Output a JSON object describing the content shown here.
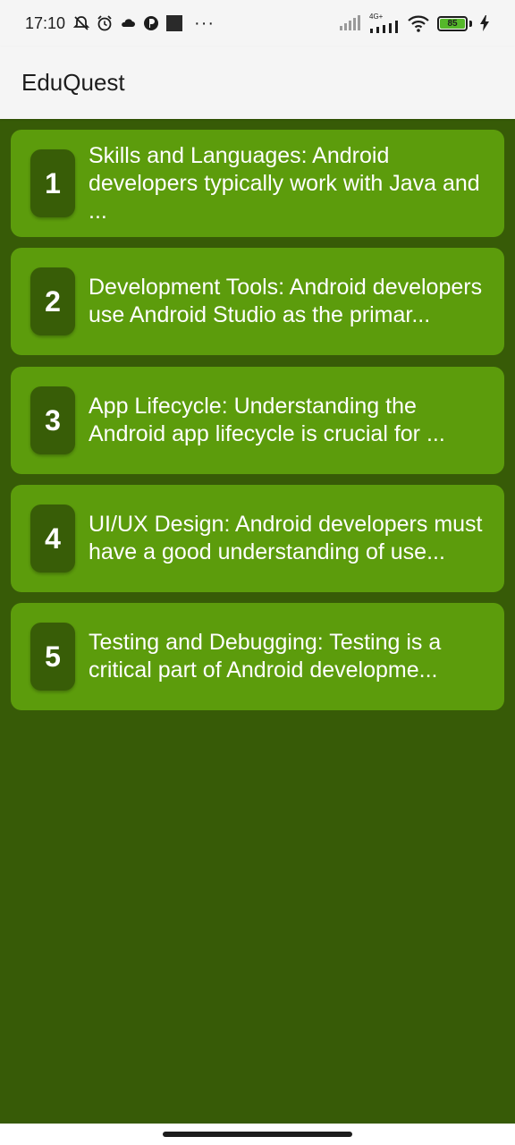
{
  "status_bar": {
    "time": "17:10",
    "more_label": "···",
    "network_label": "4G+",
    "battery_level": "85"
  },
  "app_bar": {
    "title": "EduQuest"
  },
  "colors": {
    "background": "#375b07",
    "card": "#5c9c0c",
    "badge": "#385d07",
    "app_bar": "#f5f5f5"
  },
  "items": [
    {
      "number": "1",
      "text": "Skills and Languages: Android developers typically work with Java and ..."
    },
    {
      "number": "2",
      "text": "Development Tools: Android developers use Android Studio as the primar..."
    },
    {
      "number": "3",
      "text": "App Lifecycle: Understanding the Android app lifecycle is crucial for ..."
    },
    {
      "number": "4",
      "text": "UI/UX Design: Android developers must have a good understanding of use..."
    },
    {
      "number": "5",
      "text": "Testing and Debugging: Testing is a critical part of Android developme..."
    }
  ]
}
